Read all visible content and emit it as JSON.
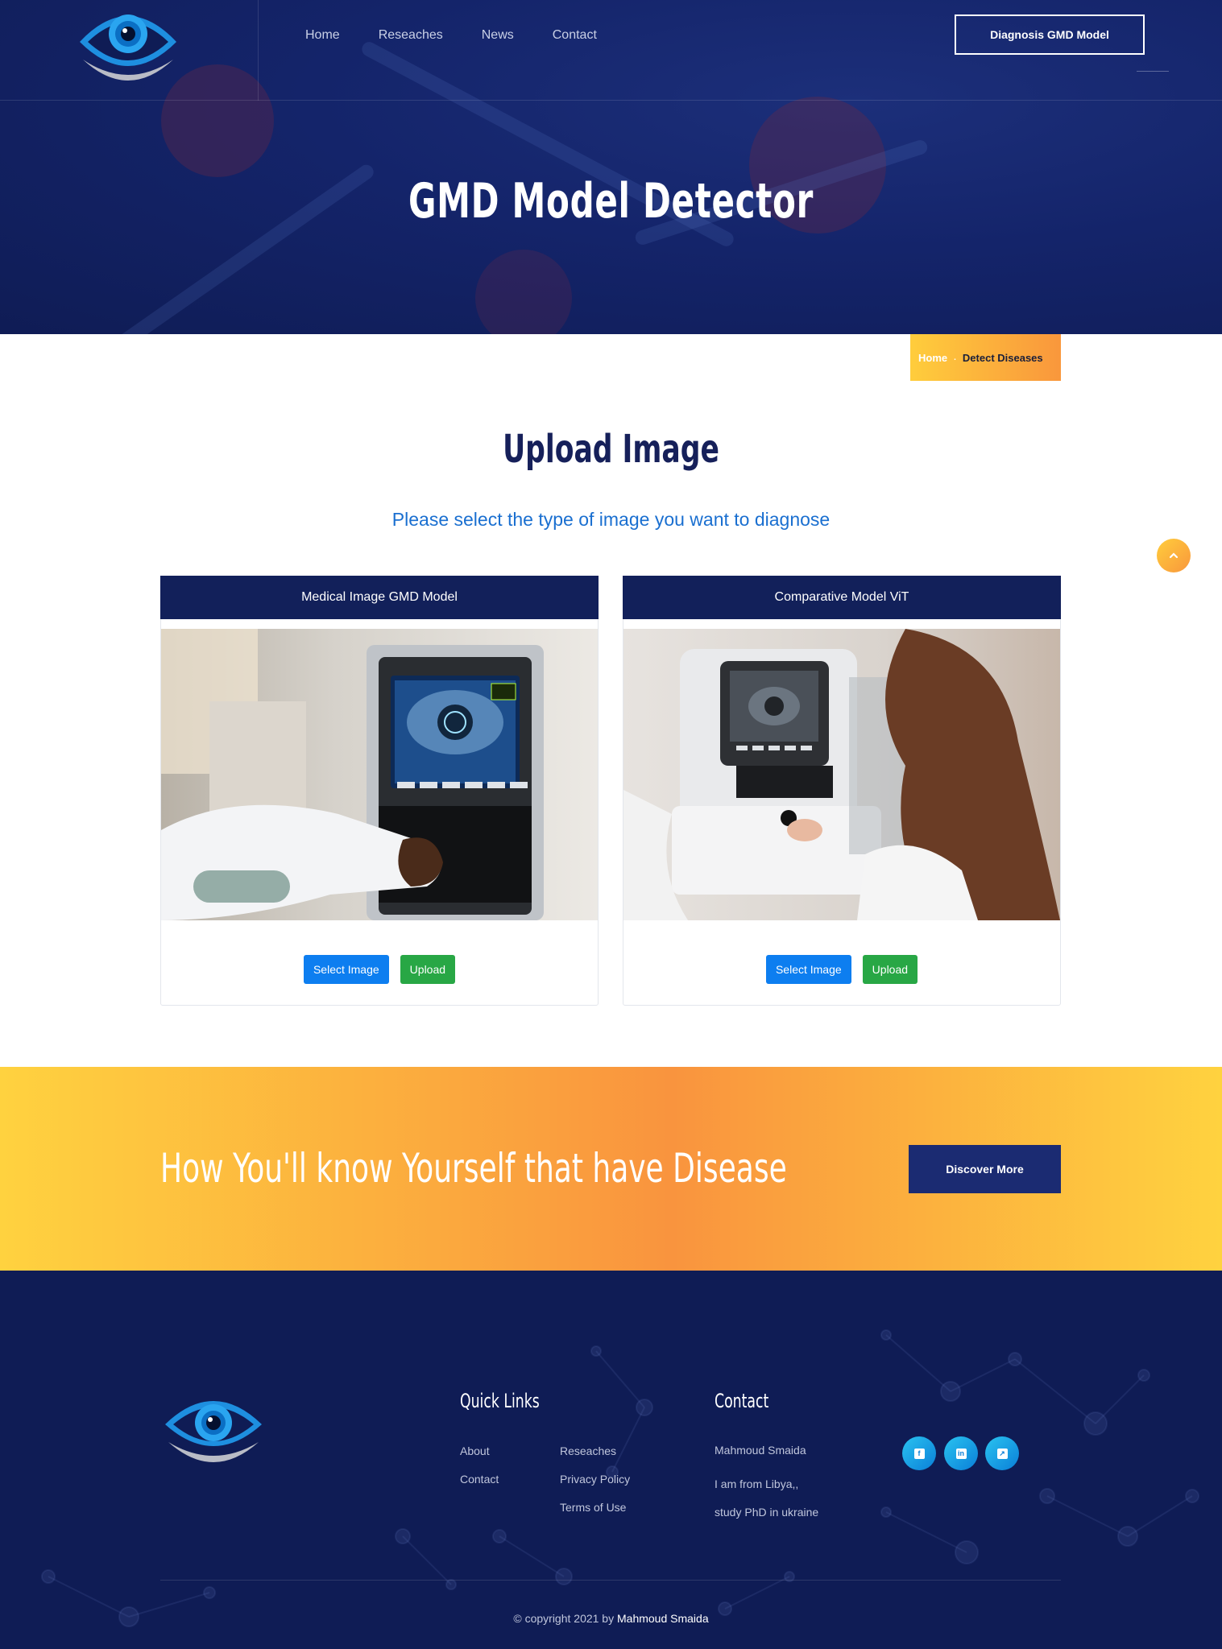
{
  "header": {
    "nav": [
      "Home",
      "Reseaches",
      "News",
      "Contact"
    ],
    "cta_label": "Diagnosis GMD Model"
  },
  "hero": {
    "title": "GMD Model Detector"
  },
  "breadcrumb": {
    "home": "Home",
    "separator": ".",
    "current": "Detect Diseases"
  },
  "upload": {
    "title": "Upload Image",
    "subtitle": "Please select the type of image you want to diagnose",
    "cards": [
      {
        "title": "Medical Image GMD Model",
        "select_label": "Select Image",
        "upload_label": "Upload"
      },
      {
        "title": "Comparative Model ViT",
        "select_label": "Select Image",
        "upload_label": "Upload"
      }
    ]
  },
  "banner": {
    "text": "How You'll know Yourself that have Disease",
    "button_label": "Discover More"
  },
  "footer": {
    "quick_links_title": "Quick Links",
    "quick_links_col1": [
      "About",
      "Contact"
    ],
    "quick_links_col2": [
      "Reseaches",
      "Privacy Policy",
      "Terms of Use"
    ],
    "contact_title": "Contact",
    "contact_name": "Mahmoud Smaida",
    "contact_line1": "I am from Libya,,",
    "contact_line2": "study PhD in ukraine",
    "social": [
      "facebook-icon",
      "linkedin-icon",
      "external-link-icon"
    ],
    "copyright_prefix": "© copyright 2021 by",
    "copyright_name": "Mahmoud Smaida"
  },
  "colors": {
    "navy": "#12205a",
    "accent_orange": "#f9973c",
    "accent_yellow": "#ffcd3c",
    "subtitle_blue": "#1a6fd0",
    "select_blue": "#0d7ef0",
    "upload_green": "#28a745"
  }
}
